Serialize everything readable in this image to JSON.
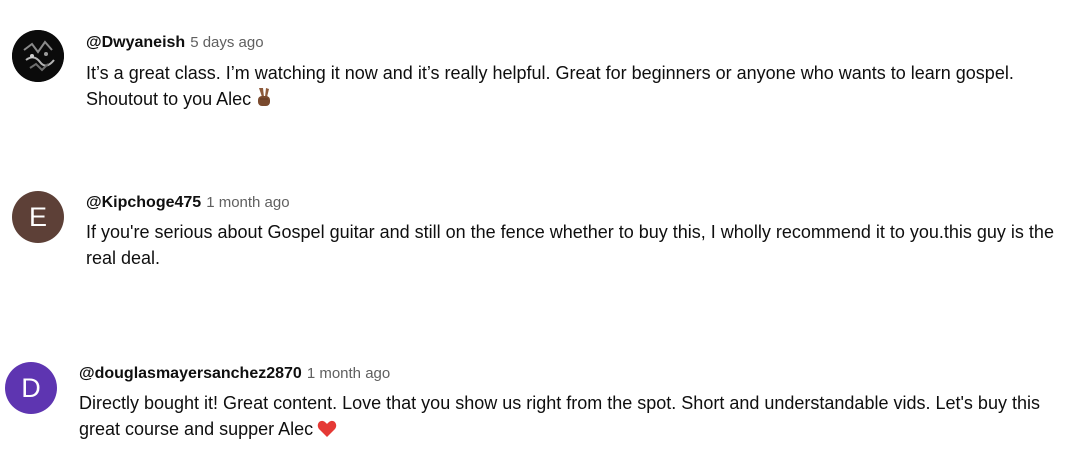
{
  "comments": [
    {
      "author": "@Dwyaneish",
      "time": "5 days ago",
      "text": "It’s a great class. I’m watching it now and it’s really helpful. Great for beginners or anyone who wants to learn gospel. Shoutout to you Alec",
      "emoji_icon": "victory-hand-emoji",
      "avatar": {
        "type": "image",
        "icon": "dark-graffiti-avatar",
        "color": "#0b0b0b"
      }
    },
    {
      "author": "@Kipchoge475",
      "time": "1 month ago",
      "text": "If you're serious about Gospel guitar and still on the fence whether to buy this, I wholly recommend it to you.this guy is the real deal.",
      "avatar": {
        "type": "letter",
        "letter": "E",
        "color": "#5d4037"
      }
    },
    {
      "author": "@douglasmayersanchez2870",
      "time": "1 month ago",
      "text": "Directly bought it! Great content. Love that you show us right from the spot. Short and understandable vids. Let's buy this great course and supper Alec",
      "emoji_icon": "red-heart-emoji",
      "avatar": {
        "type": "letter",
        "letter": "D",
        "color": "#5e35b1"
      }
    }
  ]
}
